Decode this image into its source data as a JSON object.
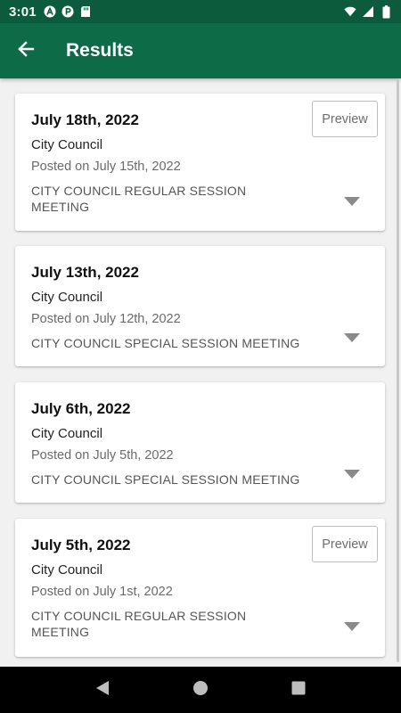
{
  "status_bar": {
    "time": "3:01",
    "icons": [
      "app-a-icon",
      "app-p-icon",
      "sd-card-icon"
    ],
    "right_icons": [
      "wifi-icon",
      "signal-icon",
      "battery-icon"
    ]
  },
  "app_bar": {
    "title": "Results",
    "back_icon": "arrow-left-icon"
  },
  "colors": {
    "status_bar": "#0b5b3c",
    "app_bar": "#0e6b48",
    "background": "#f1f1f1"
  },
  "results": [
    {
      "date": "July 18th, 2022",
      "org": "City Council",
      "posted": "Posted on July 15th, 2022",
      "meeting": "CITY COUNCIL REGULAR SESSION MEETING",
      "has_preview": true,
      "preview_label": "Preview"
    },
    {
      "date": "July 13th, 2022",
      "org": "City Council",
      "posted": "Posted on July 12th, 2022",
      "meeting": "CITY COUNCIL SPECIAL SESSION MEETING",
      "has_preview": false
    },
    {
      "date": "July 6th, 2022",
      "org": "City Council",
      "posted": "Posted on July 5th, 2022",
      "meeting": "CITY COUNCIL SPECIAL SESSION MEETING",
      "has_preview": false
    },
    {
      "date": "July 5th, 2022",
      "org": "City Council",
      "posted": "Posted on July 1st, 2022",
      "meeting": "CITY COUNCIL REGULAR SESSION MEETING",
      "has_preview": true,
      "preview_label": "Preview"
    }
  ],
  "nav_bar": {
    "buttons": [
      "back-triangle-icon",
      "home-circle-icon",
      "recents-square-icon"
    ]
  }
}
